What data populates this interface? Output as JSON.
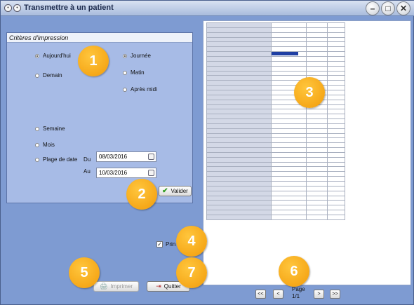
{
  "window": {
    "title": "Transmettre à un patient"
  },
  "criteria": {
    "heading": "Critères d'impression",
    "options": {
      "today": "Aujourd'hui",
      "tomorrow": "Demain",
      "week": "Semaine",
      "month": "Mois",
      "date_range": "Plage de date"
    },
    "period": {
      "day": "Journée",
      "morning": "Matin",
      "afternoon": "Après midi"
    },
    "from_label": "Du",
    "from_value": "08/03/2016",
    "to_label": "Au",
    "to_value": "10/03/2016",
    "validate_label": "Valider"
  },
  "print_checkbox": {
    "label": "Prin",
    "checked": true
  },
  "actions": {
    "print_label": "Imprimer",
    "quit_label": "Quitter"
  },
  "pagination": {
    "first": "<<",
    "prev": "<",
    "next": ">",
    "last": ">>",
    "page_label": "Page",
    "page_value": "1/1"
  },
  "badges": [
    "1",
    "2",
    "3",
    "4",
    "5",
    "6",
    "7"
  ],
  "colors": {
    "badge": "#f4a20c",
    "event": "#1f3fa3",
    "window_bg": "#7e9bd2",
    "panel_bg": "#a7bbe6"
  }
}
